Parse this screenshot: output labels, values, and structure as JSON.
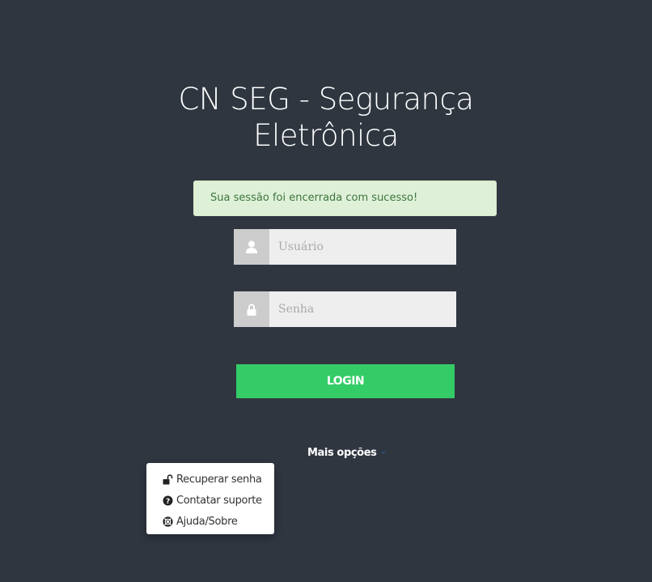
{
  "header": {
    "title_line1": "CN SEG - Segurança",
    "title_line2": "Eletrônica"
  },
  "alert": {
    "message": "Sua sessão foi encerrada com sucesso!"
  },
  "login_form": {
    "username": {
      "icon": "user-icon",
      "placeholder": "Usuário",
      "value": ""
    },
    "password": {
      "icon": "lock-icon",
      "placeholder": "Senha",
      "value": ""
    },
    "submit_label": "LOGIN"
  },
  "more_options": {
    "label": "Mais opções",
    "items": [
      {
        "icon": "unlock-icon",
        "label": "Recuperar senha"
      },
      {
        "icon": "question-circle-icon",
        "label": "Contatar suporte"
      },
      {
        "icon": "life-ring-icon",
        "label": "Ajuda/Sobre"
      }
    ]
  },
  "colors": {
    "background": "#2f3640",
    "alert_bg": "#dff0d8",
    "alert_text": "#3c763d",
    "login_button": "#33cc66",
    "input_bg": "#eeeeee",
    "addon_bg": "#cccccc"
  }
}
